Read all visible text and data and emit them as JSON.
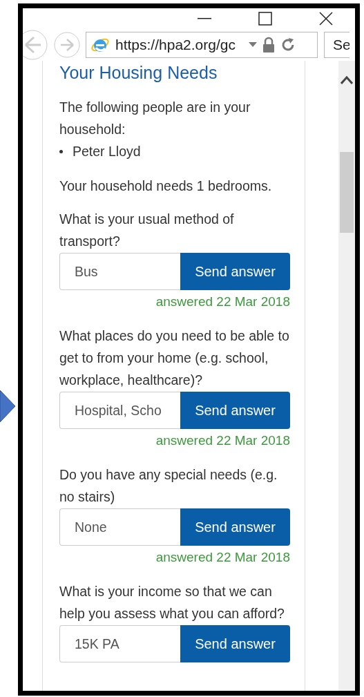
{
  "browser": {
    "url": "https://hpa2.org/gc",
    "search_placeholder": "Se"
  },
  "page": {
    "title": "Your Housing Needs",
    "intro": "The following people are in your household:",
    "people": [
      "Peter Lloyd"
    ],
    "bedrooms_note": "Your household needs 1 bedrooms.",
    "questions": [
      {
        "text": "What is your usual method of transport?",
        "answer": "Bus",
        "button": "Send answer",
        "answered": "answered 22 Mar 2018"
      },
      {
        "text": "What places do you need to be able to get to from your home (e.g. school, workplace, healthcare)?",
        "answer": "Hospital, Scho",
        "button": "Send answer",
        "answered": "answered 22 Mar 2018"
      },
      {
        "text": "Do you have any special needs (e.g. no stairs)",
        "answer": "None",
        "button": "Send answer",
        "answered": "answered 22 Mar 2018"
      },
      {
        "text": "What is your income so that we can help you assess what you can afford?",
        "answer": "15K PA",
        "button": "Send answer"
      }
    ]
  }
}
